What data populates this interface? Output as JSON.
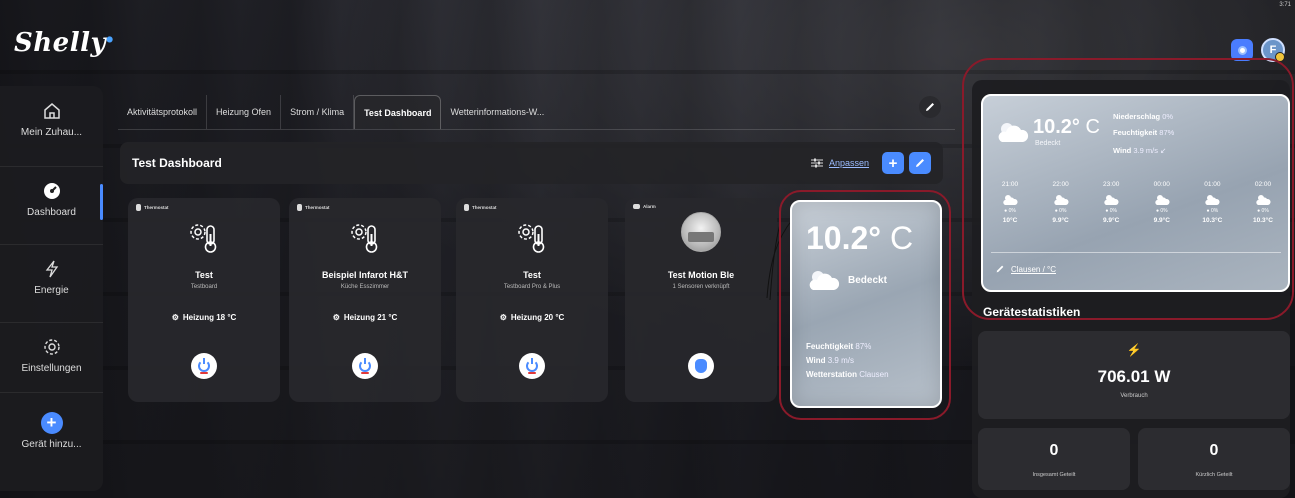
{
  "app": {
    "logo": "Shelly",
    "clock": "3:71"
  },
  "header": {
    "avatar_initial": "F"
  },
  "sidebar": {
    "items": [
      {
        "label": "Mein Zuhau...",
        "icon": "home-icon"
      },
      {
        "label": "Dashboard",
        "icon": "dashboard-icon",
        "active": true
      },
      {
        "label": "Energie",
        "icon": "lightning-icon"
      },
      {
        "label": "Einstellungen",
        "icon": "gear-icon"
      },
      {
        "label": "Gerät hinzu...",
        "icon": "plus-icon"
      }
    ]
  },
  "tabs": [
    {
      "label": "Aktivitätsprotokoll"
    },
    {
      "label": "Heizung Ofen"
    },
    {
      "label": "Strom / Klima"
    },
    {
      "label": "Test Dashboard",
      "active": true
    },
    {
      "label": "Wetterinformations-W..."
    }
  ],
  "dashboard": {
    "title": "Test Dashboard",
    "customize_label": "Anpassen"
  },
  "cards": [
    {
      "tag": "Thermostat",
      "name": "Test",
      "sub": "Testboard",
      "status": "Heizung 18 °C",
      "icon": "thermostat-icon"
    },
    {
      "tag": "Thermostat",
      "name": "Beispiel Infarot H&T",
      "sub": "Küche Esszimmer",
      "status": "Heizung 21 °C",
      "icon": "thermostat-icon"
    },
    {
      "tag": "Thermostat",
      "name": "Test",
      "sub": "Testboard Pro & Plus",
      "status": "Heizung 20 °C",
      "icon": "thermostat-icon"
    },
    {
      "tag": "Alarm",
      "name": "Test Motion Ble",
      "sub": "1 Sensoren verknüpft",
      "status": "",
      "icon": "motion-sensor-photo"
    }
  ],
  "weather_card": {
    "temp": "10.2°",
    "unit": "C",
    "condition": "Bedeckt",
    "humidity_label": "Feuchtigkeit",
    "humidity": "87%",
    "wind_label": "Wind",
    "wind": "3.9 m/s",
    "station_label": "Wetterstation",
    "station": "Clausen"
  },
  "weather_widget": {
    "temp": "10.2°",
    "unit": "C",
    "condition": "Bedeckt",
    "precip_label": "Niederschlag",
    "precip": "0%",
    "humidity_label": "Feuchtigkeit",
    "humidity": "87%",
    "wind_label": "Wind",
    "wind": "3.9 m/s ↙",
    "hours": [
      {
        "time": "21:00",
        "precip": "● 0%",
        "temp": "10°C"
      },
      {
        "time": "22:00",
        "precip": "● 0%",
        "temp": "9.9°C"
      },
      {
        "time": "23:00",
        "precip": "● 0%",
        "temp": "9.9°C"
      },
      {
        "time": "00:00",
        "precip": "● 0%",
        "temp": "9.9°C"
      },
      {
        "time": "01:00",
        "precip": "● 0%",
        "temp": "10.3°C"
      },
      {
        "time": "02:00",
        "precip": "● 0%",
        "temp": "10.3°C"
      }
    ],
    "link": "Clausen / °C"
  },
  "stats": {
    "title": "Gerätestatistiken",
    "power_value": "706.01 W",
    "power_label": "Verbrauch",
    "shared_total": "0",
    "shared_total_label": "Insgesamt Geteilt",
    "shared_recent": "0",
    "shared_recent_label": "Kürzlich Geteilt"
  }
}
